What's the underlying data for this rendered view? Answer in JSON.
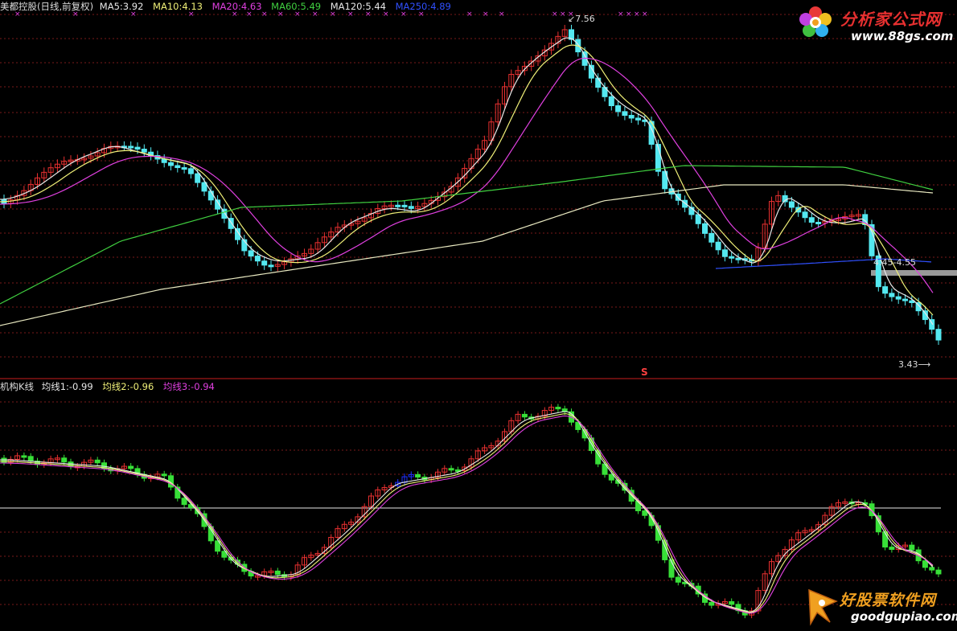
{
  "top_panel": {
    "stock_label": "美都控股(日线,前复权)",
    "ma_labels": [
      {
        "text": "MA5:3.92",
        "color": "#e8e8e8"
      },
      {
        "text": "MA10:4.13",
        "color": "#f0f078"
      },
      {
        "text": "MA20:4.63",
        "color": "#e040e0"
      },
      {
        "text": "MA60:5.49",
        "color": "#40d040"
      },
      {
        "text": "MA120:5.44",
        "color": "#e8e8e8"
      },
      {
        "text": "MA250:4.89",
        "color": "#3050ff"
      }
    ],
    "high_label": "7.56",
    "low_label": "3.43",
    "range_label": "4.45-4.55",
    "signal_label": "S"
  },
  "bottom_panel": {
    "indicator_label": "机构K线",
    "avg_labels": [
      {
        "text": "均线1:-0.99",
        "color": "#e8e8e8"
      },
      {
        "text": "均线2:-0.96",
        "color": "#f0f078"
      },
      {
        "text": "均线3:-0.94",
        "color": "#e040e0"
      }
    ]
  },
  "logos": {
    "top_site_name": "分析家公式网",
    "top_site_url": "www.88gs.com",
    "bottom_site_name": "好股票软件网",
    "bottom_site_url": "goodgupiao.com"
  },
  "colors": {
    "up": "#e83030",
    "down": "#54e8f0",
    "ind_down": "#38e038",
    "ind_special": "#2030ff",
    "grid": "#7a1a1a",
    "ma5": "#e8e8e8",
    "ma10": "#f0f078",
    "ma20": "#e040e0",
    "ma60": "#40d040",
    "ma120": "#e8e8c0",
    "ma250": "#3050ff",
    "marker": "#e040e0"
  }
}
